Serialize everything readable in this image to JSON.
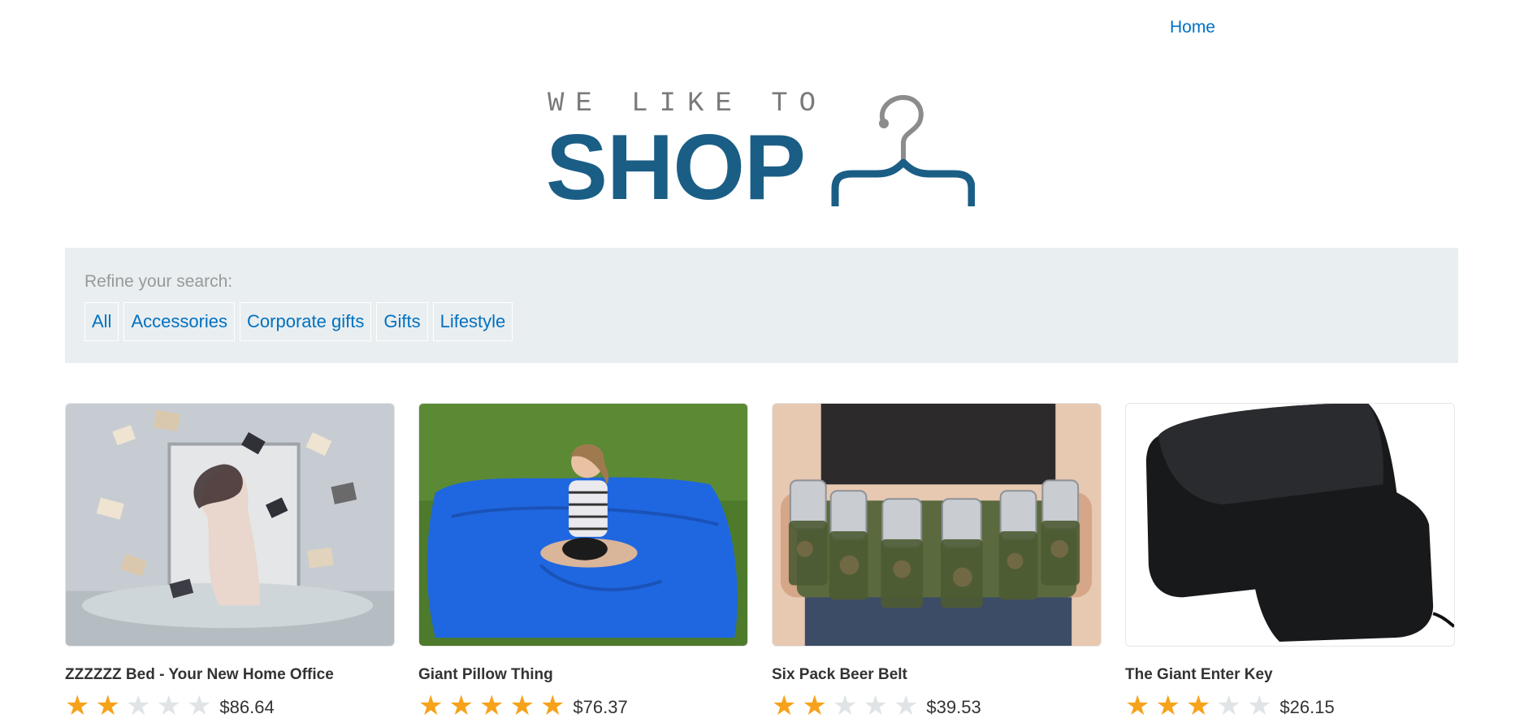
{
  "nav": {
    "home_label": "Home"
  },
  "logo": {
    "small_text": "WE LIKE TO",
    "big_text": "SHOP"
  },
  "filters": {
    "label": "Refine your search:",
    "items": [
      "All",
      "Accessories",
      "Corporate gifts",
      "Gifts",
      "Lifestyle"
    ]
  },
  "products": [
    {
      "title": "ZZZZZZ Bed - Your New Home Office",
      "rating": 2,
      "price": "$86.64",
      "image": "bed-photo"
    },
    {
      "title": "Giant Pillow Thing",
      "rating": 5,
      "price": "$76.37",
      "image": "pillow-photo"
    },
    {
      "title": "Six Pack Beer Belt",
      "rating": 2,
      "price": "$39.53",
      "image": "beer-belt-photo"
    },
    {
      "title": "The Giant Enter Key",
      "rating": 3,
      "price": "$26.15",
      "image": "enter-key-photo"
    }
  ],
  "colors": {
    "link": "#0071c1",
    "logo": "#1a5e86",
    "panel": "#e9eef0",
    "star": "#f7a21b"
  }
}
